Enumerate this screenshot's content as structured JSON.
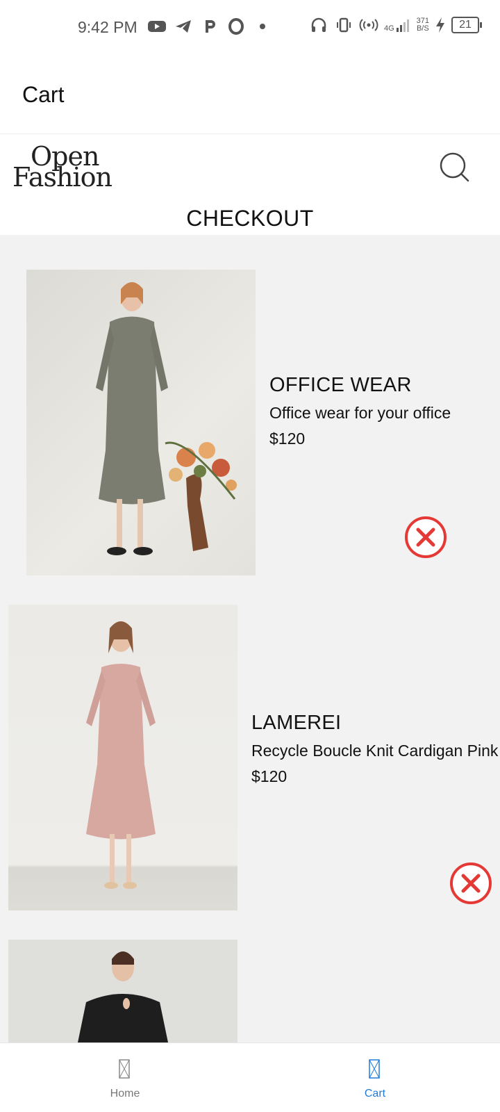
{
  "status_bar": {
    "time": "9:42 PM",
    "network_type": "4G",
    "speed_value": "371",
    "speed_unit": "B/S",
    "battery": "21",
    "icons": [
      "youtube-icon",
      "telegram-icon",
      "p-app-icon",
      "opera-icon",
      "dot-icon",
      "headphones-icon",
      "vibrate-icon",
      "hotspot-icon",
      "signal-icon",
      "charging-icon",
      "battery-icon"
    ]
  },
  "header": {
    "title": "Cart"
  },
  "brand": {
    "logo_line1": "Open",
    "logo_line2": "Fashion",
    "heading": "CHECKOUT"
  },
  "cart": {
    "items": [
      {
        "name": "OFFICE WEAR",
        "description": "Office wear for your office",
        "price": "$120",
        "image": "woman-grey-dress-photo"
      },
      {
        "name": "LAMEREI",
        "description": "Recycle Boucle Knit Cardigan Pink",
        "price": "$120",
        "image": "woman-pink-dress-photo"
      },
      {
        "image": "woman-black-top-photo"
      }
    ]
  },
  "bottom_nav": {
    "tabs": [
      {
        "label": "Home",
        "active": false
      },
      {
        "label": "Cart",
        "active": true
      }
    ]
  },
  "colors": {
    "accent": "#1e7bd6",
    "remove_red": "#e53935",
    "content_bg": "#f2f2f2"
  }
}
